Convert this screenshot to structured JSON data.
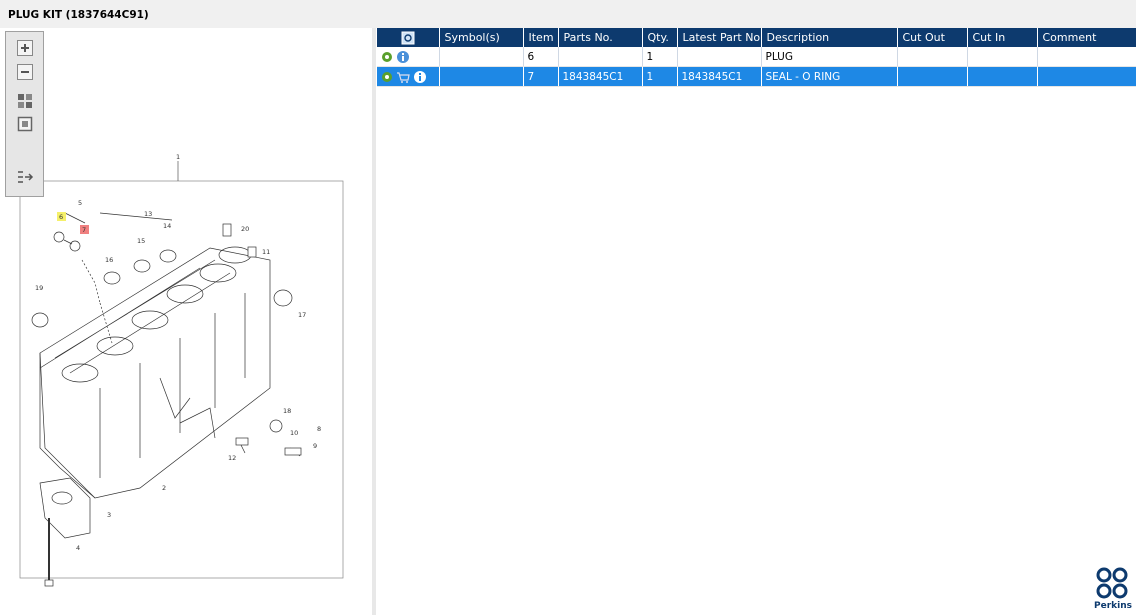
{
  "window": {
    "title": "PLUG KIT (1837644C91)"
  },
  "toolbar": {
    "buttons": [
      {
        "name": "zoom-in-button",
        "icon": "plus-icon"
      },
      {
        "name": "zoom-out-button",
        "icon": "minus-icon"
      },
      {
        "name": "fit-button",
        "icon": "grid-icon"
      },
      {
        "name": "actual-size-button",
        "icon": "square-icon"
      },
      {
        "name": "export-button",
        "icon": "list-arrow-icon"
      }
    ]
  },
  "drawing": {
    "callouts": [
      "1",
      "2",
      "3",
      "4",
      "5",
      "6",
      "7",
      "8",
      "9",
      "10",
      "11",
      "12",
      "13",
      "14",
      "15",
      "16",
      "17",
      "18",
      "19",
      "20",
      "16"
    ]
  },
  "table": {
    "headers": [
      "",
      "Symbol(s)",
      "Item",
      "Parts No.",
      "Qty.",
      "Latest Part No.",
      "Description",
      "Cut Out",
      "Cut In",
      "Comment"
    ],
    "rows": [
      {
        "symbols": "",
        "item": "6",
        "parts_no": "",
        "qty": "1",
        "latest_part_no": "",
        "description": "PLUG",
        "cut_out": "",
        "cut_in": "",
        "comment": "",
        "selected": false,
        "icons": [
          "gear-icon",
          "info-icon"
        ]
      },
      {
        "symbols": "",
        "item": "7",
        "parts_no": "1843845C1",
        "qty": "1",
        "latest_part_no": "1843845C1",
        "description": "SEAL - O RING",
        "cut_out": "",
        "cut_in": "",
        "comment": "",
        "selected": true,
        "icons": [
          "gear-icon",
          "cart-icon",
          "info-icon"
        ]
      }
    ]
  },
  "brand": {
    "logo_text": "Perkins",
    "color": "#0d3a6e"
  },
  "colors": {
    "header": "#0d3a6e",
    "selected_row": "#1e88e5",
    "highlight_yellow": "#f5f06a",
    "highlight_red": "#f08080"
  }
}
